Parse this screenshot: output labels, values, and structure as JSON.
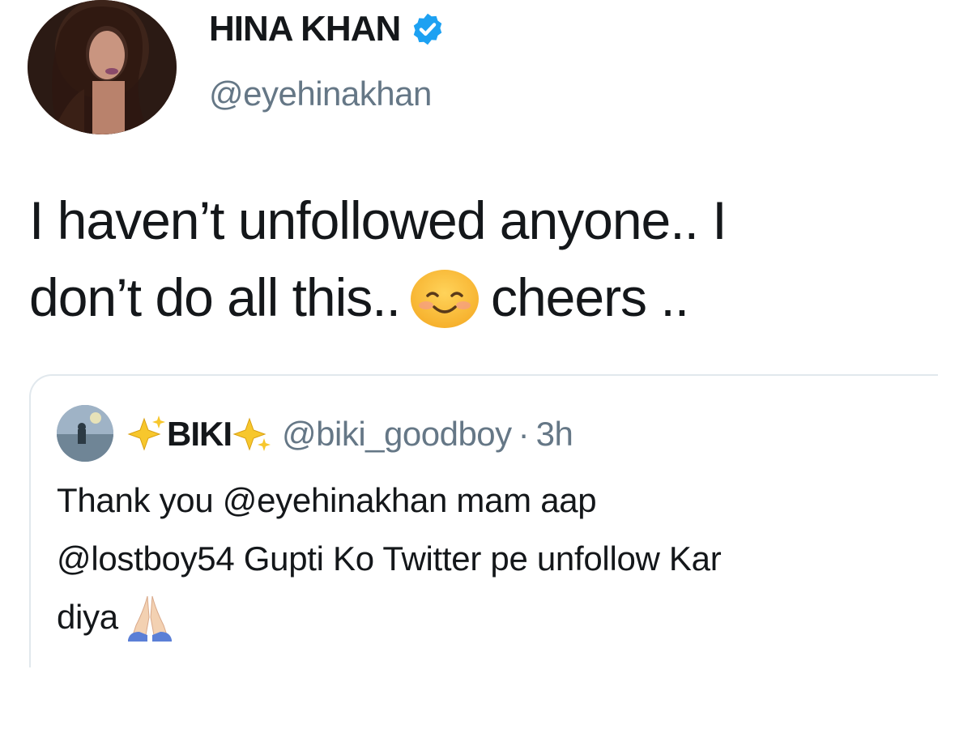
{
  "author": {
    "display_name": "HINA KHAN",
    "handle": "@eyehinakhan",
    "verified": true
  },
  "tweet": {
    "line1": "I haven’t unfollowed anyone.. I",
    "line2_before_emoji": "don’t do all this..",
    "emoji": "smiling-face-with-smiling-eyes",
    "line2_after_emoji": "cheers .."
  },
  "quoted_tweet": {
    "display_name": "BIKI",
    "name_decoration": "sparkles",
    "handle": "@biki_goodboy",
    "separator": "·",
    "time": "3h",
    "line1": "Thank you @eyehinakhan mam aap",
    "line2": "@lostboy54 Gupti Ko Twitter pe unfollow Kar",
    "line3": "diya",
    "emoji": "folded-hands"
  },
  "colors": {
    "text_primary": "#14171a",
    "text_secondary": "#657786",
    "verified_blue": "#1da1f2",
    "card_border": "#e1e8ed"
  }
}
